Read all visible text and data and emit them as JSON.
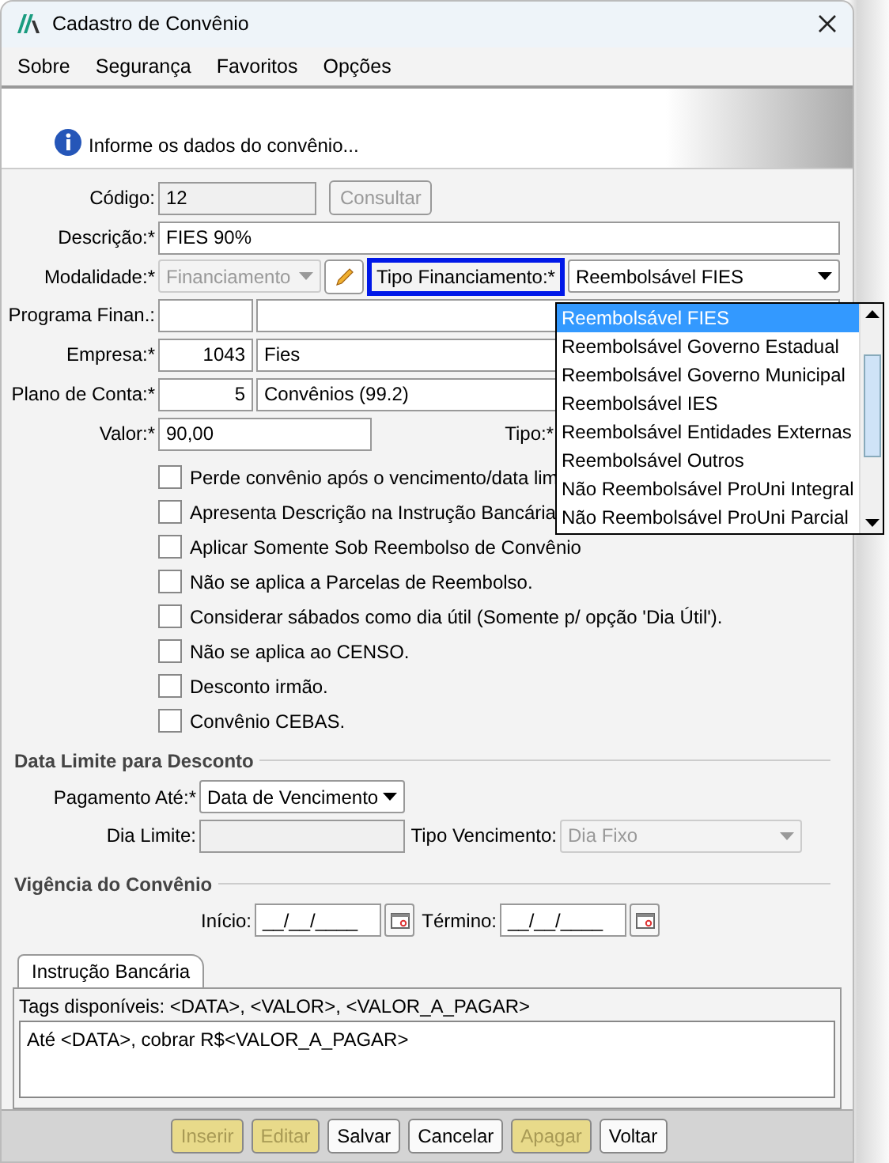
{
  "window": {
    "title": "Cadastro de Convênio"
  },
  "menu": [
    {
      "label": "Sobre"
    },
    {
      "label": "Segurança"
    },
    {
      "label": "Favoritos"
    },
    {
      "label": "Opções"
    }
  ],
  "info_message": "Informe os dados do convênio...",
  "form": {
    "codigo": {
      "label": "Código:",
      "value": "12",
      "disabled": true
    },
    "consultar_button": {
      "label": "Consultar",
      "disabled": true
    },
    "descricao": {
      "label": "Descrição:*",
      "value": "FIES 90%"
    },
    "modalidade": {
      "label": "Modalidade:*",
      "value": "Financiamento",
      "disabled": true
    },
    "tipo_financiamento": {
      "label": "Tipo Financiamento:*",
      "highlighted": true,
      "value": "Reembolsável FIES",
      "expanded": true,
      "options": [
        {
          "label": "Reembolsável FIES",
          "selected": true
        },
        {
          "label": "Reembolsável Governo Estadual",
          "selected": false
        },
        {
          "label": "Reembolsável Governo Municipal",
          "selected": false
        },
        {
          "label": "Reembolsável IES",
          "selected": false
        },
        {
          "label": "Reembolsável Entidades Externas",
          "selected": false
        },
        {
          "label": "Reembolsável Outros",
          "selected": false
        },
        {
          "label": "Não Reembolsável ProUni Integral",
          "selected": false
        },
        {
          "label": "Não Reembolsável ProUni Parcial",
          "selected": false
        }
      ]
    },
    "programa_finan": {
      "label": "Programa Finan.:"
    },
    "empresa": {
      "label": "Empresa:*",
      "code": "1043",
      "name": "Fies"
    },
    "plano_de_conta": {
      "label": "Plano de Conta:*",
      "code": "5",
      "name": "Convênios (99.2)"
    },
    "valor": {
      "label": "Valor:*",
      "value": "90,00"
    },
    "tipo": {
      "label": "Tipo:*"
    }
  },
  "checkboxes": [
    {
      "label": "Perde convênio após o vencimento/data lim",
      "checked": false
    },
    {
      "label": "Apresenta Descrição na Instrução Bancária",
      "checked": false
    },
    {
      "label": "Aplicar Somente Sob Reembolso de Convênio",
      "checked": false
    },
    {
      "label": "Não se aplica a Parcelas de Reembolso.",
      "checked": false
    },
    {
      "label": "Considerar sábados como dia útil (Somente p/ opção 'Dia Útil').",
      "checked": false
    },
    {
      "label": "Não se aplica ao CENSO.",
      "checked": false
    },
    {
      "label": "Desconto irmão.",
      "checked": false
    },
    {
      "label": "Convênio CEBAS.",
      "checked": false
    }
  ],
  "data_limite": {
    "title": "Data Limite para Desconto",
    "pagamento_ate": {
      "label": "Pagamento Até:*",
      "value": "Data de Vencimento"
    },
    "dia_limite": {
      "label": "Dia Limite:"
    },
    "tipo_vencimento": {
      "label": "Tipo Vencimento:",
      "value": "Dia Fixo",
      "disabled": true
    }
  },
  "vigencia": {
    "title": "Vigência do Convênio",
    "inicio": {
      "label": "Início:",
      "value": "__/__/____"
    },
    "termino": {
      "label": "Término:",
      "value": "__/__/____"
    }
  },
  "tabs": [
    {
      "label": "Instrução Bancária",
      "selected": true
    }
  ],
  "instrucao": {
    "tags_hint": "Tags disponíveis: <DATA>, <VALOR>, <VALOR_A_PAGAR>",
    "text": "Até <DATA>, cobrar R$<VALOR_A_PAGAR>"
  },
  "buttons": [
    {
      "label": "Inserir",
      "disabled": true
    },
    {
      "label": "Editar",
      "disabled": true
    },
    {
      "label": "Salvar",
      "disabled": false
    },
    {
      "label": "Cancelar",
      "disabled": false
    },
    {
      "label": "Apagar",
      "disabled": true
    },
    {
      "label": "Voltar",
      "disabled": false
    }
  ]
}
